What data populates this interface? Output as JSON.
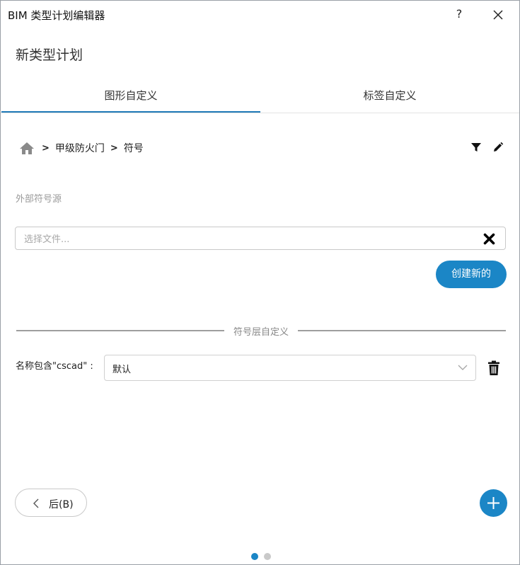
{
  "window": {
    "title": "BIM 类型计划编辑器",
    "help_label": "?"
  },
  "page": {
    "title": "新类型计划"
  },
  "tabs": [
    {
      "label": "图形自定义",
      "active": true
    },
    {
      "label": "标签自定义",
      "active": false
    }
  ],
  "breadcrumb": {
    "separator": ">",
    "items": [
      "甲级防火门",
      "符号"
    ]
  },
  "external_source": {
    "label": "外部符号源",
    "placeholder": "选择文件...",
    "value": "",
    "create_label": "创建新的"
  },
  "layer_section": {
    "divider_label": "符号层自定义",
    "row_label": "名称包含\"cscad\" :",
    "selected_value": "默认"
  },
  "footer": {
    "back_label": "后(B)",
    "pager_pages": 2,
    "pager_active": 1
  },
  "colors": {
    "accent": "#1b86c6",
    "tab_underline": "#1f7ab8",
    "border": "#c9c9c9",
    "muted_text": "#9a9a9a"
  },
  "icons": {
    "close": "close-icon",
    "home": "home-icon",
    "filter": "filter-icon",
    "edit": "pencil-icon",
    "clear": "x-icon",
    "dropdown": "chevron-down-icon",
    "delete": "trash-icon",
    "back": "chevron-left-icon",
    "add": "plus-icon"
  }
}
